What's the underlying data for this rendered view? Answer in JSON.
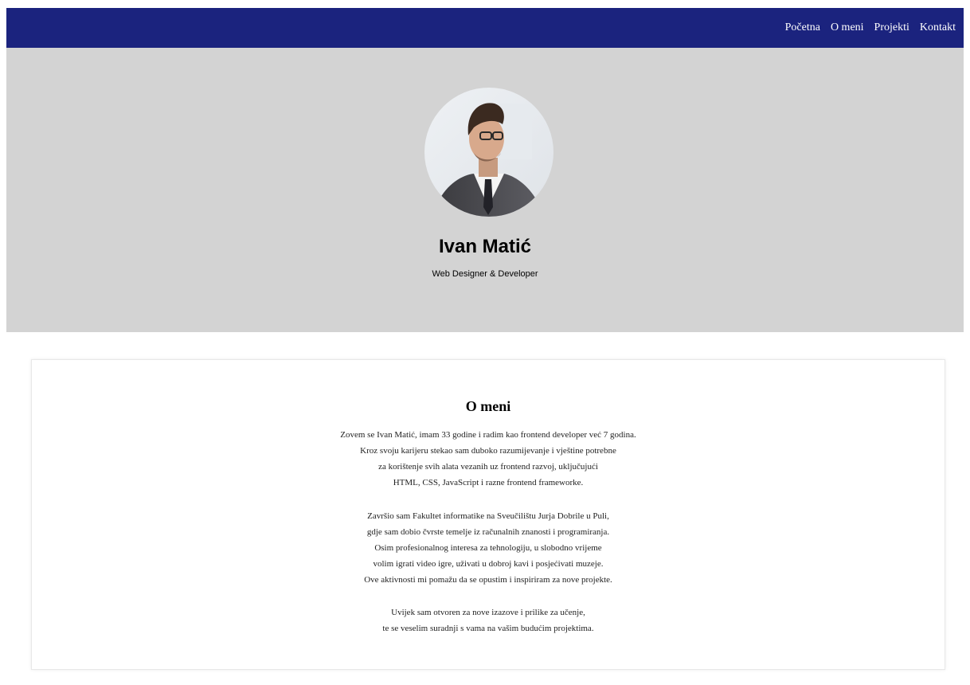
{
  "nav": {
    "links": [
      "Početna",
      "O meni",
      "Projekti",
      "Kontakt"
    ]
  },
  "hero": {
    "name": "Ivan Matić",
    "role": "Web Designer & Developer",
    "avatar_alt": "profile photo of a man with glasses in a suit"
  },
  "about": {
    "title": "O meni",
    "paragraphs": [
      [
        "Zovem se Ivan Matić, imam 33 godine i radim kao frontend developer već 7 godina.",
        "Kroz svoju karijeru stekao sam duboko razumijevanje i vještine potrebne",
        "za korištenje svih alata vezanih uz frontend razvoj, uključujući",
        "HTML, CSS, JavaScript i razne frontend frameworke."
      ],
      [
        "Završio sam Fakultet informatike na Sveučilištu Jurja Dobrile u Puli,",
        "gdje sam dobio čvrste temelje iz računalnih znanosti i programiranja.",
        "Osim profesionalnog interesa za tehnologiju, u slobodno vrijeme",
        "volim igrati video igre, uživati u dobroj kavi i posjećivati muzeje.",
        "Ove aktivnosti mi pomažu da se opustim i inspiriram za nove projekte."
      ],
      [
        "Uvijek sam otvoren za nove izazove i prilike za učenje,",
        "te se veselim suradnji s vama na vašim budućim projektima."
      ]
    ]
  },
  "colors": {
    "nav_bg": "#1b237e",
    "hero_bg": "#d3d3d3",
    "card_bg": "#ffffff"
  }
}
